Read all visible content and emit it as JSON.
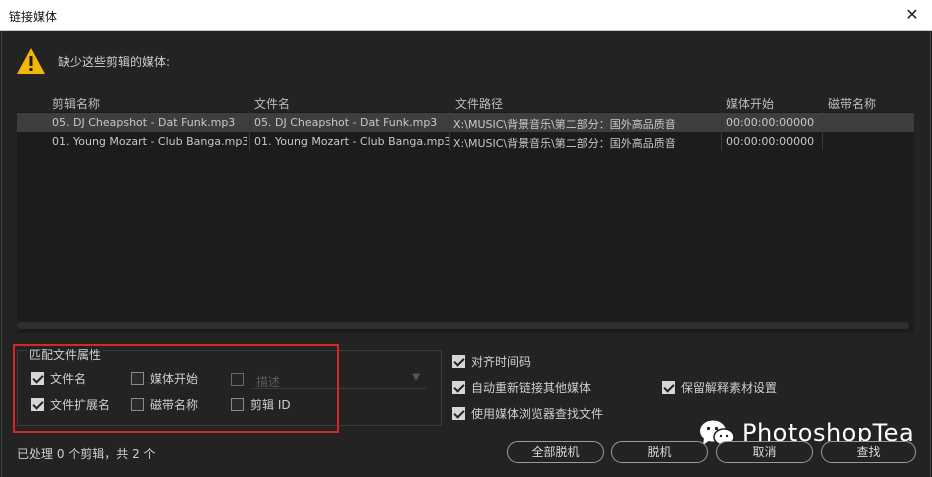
{
  "window": {
    "title": "链接媒体",
    "close_icon": "close-icon"
  },
  "message": "缺少这些剪辑的媒体:",
  "table": {
    "headers": [
      "剪辑名称",
      "文件名",
      "文件路径",
      "媒体开始",
      "磁带名称"
    ],
    "rows": [
      {
        "clip": "05. DJ Cheapshot - Dat Funk.mp3",
        "file": "05. DJ Cheapshot - Dat Funk.mp3",
        "path": "X:\\MUSIC\\背景音乐\\第二部分：国外高品质音",
        "start": "00:00:00:00000",
        "tape": "",
        "selected": true
      },
      {
        "clip": "01. Young Mozart - Club Banga.mp3",
        "file": "01. Young Mozart - Club Banga.mp3",
        "path": "X:\\MUSIC\\背景音乐\\第二部分：国外高品质音",
        "start": "00:00:00:00000",
        "tape": "",
        "selected": false
      }
    ]
  },
  "match": {
    "label": "匹配文件属性",
    "options": [
      {
        "label": "文件名",
        "checked": true
      },
      {
        "label": "媒体开始",
        "checked": false
      },
      {
        "label": "",
        "checked": false
      },
      {
        "label": "文件扩展名",
        "checked": true
      },
      {
        "label": "磁带名称",
        "checked": false
      },
      {
        "label": "剪辑 ID",
        "checked": false
      }
    ],
    "description_select": "描述"
  },
  "options": [
    {
      "label": "对齐时间码",
      "checked": true
    },
    {
      "label": "自动重新链接其他媒体",
      "checked": true
    },
    {
      "label": "保留解释素材设置",
      "checked": true
    },
    {
      "label": "使用媒体浏览器查找文件",
      "checked": true
    }
  ],
  "status": "已处理 0 个剪辑，共 2 个",
  "buttons": {
    "offline_all": "全部脱机",
    "offline": "脱机",
    "cancel": "取消",
    "find": "查找"
  },
  "watermark": "PhotoshopTea",
  "colors": {
    "accent_red": "#d9242a",
    "warning_yellow": "#f2b705",
    "background": "#232323"
  }
}
